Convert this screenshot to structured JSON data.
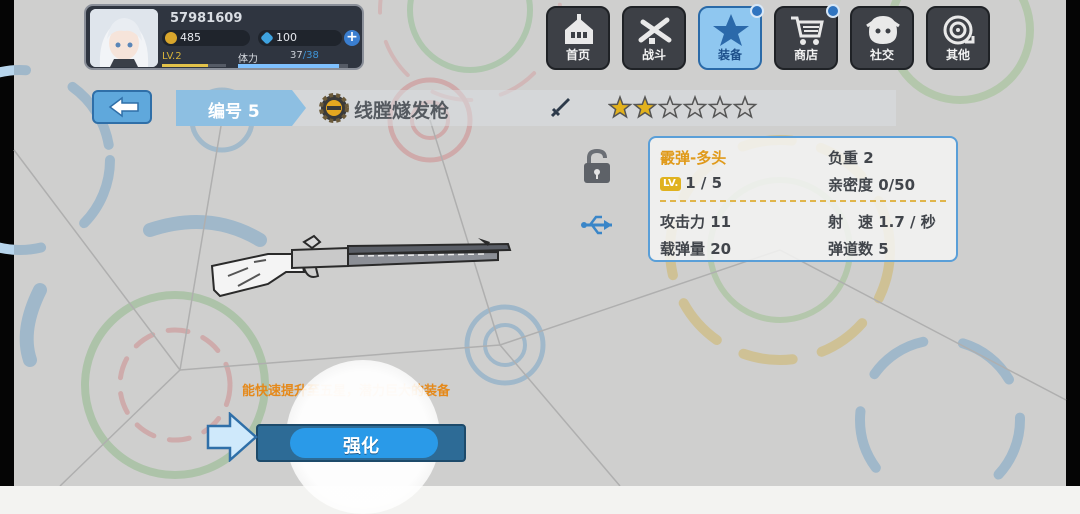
{
  "player": {
    "id": "57981609",
    "coins": "485",
    "gems": "100",
    "level": "LV.2",
    "stamina_label": "体力",
    "stamina_current": "37",
    "stamina_max": "/38",
    "level_progress": 0.72,
    "stamina_progress": 0.92
  },
  "menu": [
    {
      "label": "首页",
      "icon": "house-icon",
      "active": false,
      "notify": false
    },
    {
      "label": "战斗",
      "icon": "crossed-guns-icon",
      "active": false,
      "notify": false
    },
    {
      "label": "装备",
      "icon": "star-icon",
      "active": true,
      "notify": true
    },
    {
      "label": "商店",
      "icon": "cart-icon",
      "active": false,
      "notify": true
    },
    {
      "label": "社交",
      "icon": "face-icon",
      "active": false,
      "notify": false
    },
    {
      "label": "其他",
      "icon": "target-icon",
      "active": false,
      "notify": false
    }
  ],
  "weapon": {
    "id_label": "编号 5",
    "name": "线膛燧发枪",
    "stars_filled": 2,
    "stars_total": 6,
    "ammo_type": "霰弹-多头",
    "weight": "负重 2",
    "level_badge": "LV.",
    "level": "1 / 5",
    "intimacy": "亲密度 0/50",
    "attack": "攻击力 11",
    "fire_rate": "射　速 1.7 / 秒",
    "capacity": "载弹量 20",
    "trajectories": "弹道数 5"
  },
  "description": "能快速提升至五星，潜力巨大的装备",
  "enhance_label": "强化",
  "colors": {
    "accent": "#2a9ae8",
    "panel_border": "#5a9fd8",
    "orange": "#e09a1a",
    "star": "#e3b21c"
  }
}
